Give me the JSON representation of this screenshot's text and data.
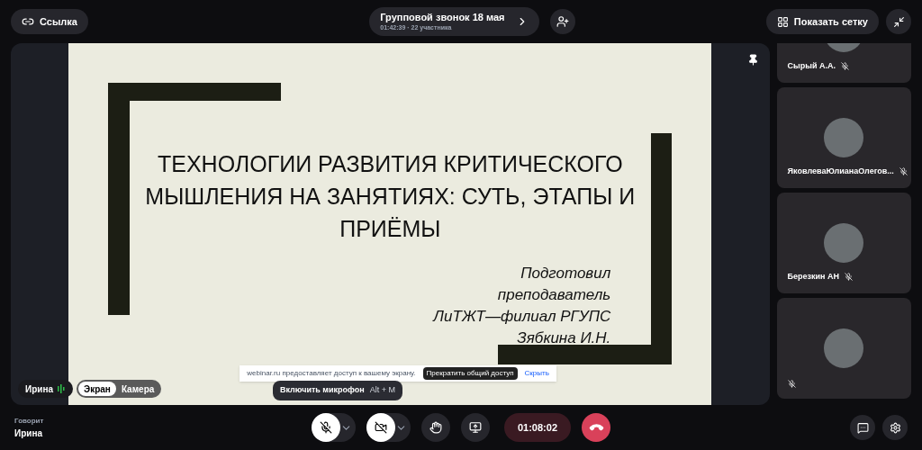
{
  "top_bar": {
    "link_button": "Ссылка",
    "call_title": "Групповой звонок 18 мая",
    "call_meta": "01:42:39 · 22 участника",
    "grid_button": "Показать сетку"
  },
  "slide": {
    "title": "ТЕХНОЛОГИИ РАЗВИТИЯ КРИТИЧЕСКОГО МЫШЛЕНИЯ НА ЗАНЯТИЯХ: СУТЬ, ЭТАПЫ И ПРИЁМЫ",
    "credits": [
      "Подготовил",
      "преподаватель",
      "ЛиТЖТ—филиал РГУПС",
      "Зябкина И.Н."
    ]
  },
  "share_notice": {
    "text": "webinar.ru предоставляет доступ к вашему экрану.",
    "stop_button": "Прекратить общий доступ",
    "hide_link": "Скрыть"
  },
  "presenter": {
    "name": "Ирина",
    "sources": [
      {
        "label": "Экран",
        "selected": true
      },
      {
        "label": "Камера",
        "selected": false
      }
    ]
  },
  "tooltip": {
    "text": "Включить микрофон",
    "shortcut": "Alt + M"
  },
  "participants": [
    {
      "name": "Сырый А.А.",
      "muted": true
    },
    {
      "name": "ЯковлеваЮлианаОлегов...",
      "muted": true
    },
    {
      "name": "Березкин АН",
      "muted": true
    },
    {
      "muted": true
    }
  ],
  "bottom_bar": {
    "speaking_label": "Говорит",
    "speaker": "Ирина",
    "mic_on": false,
    "camera_on": false,
    "timer": "01:08:02"
  }
}
